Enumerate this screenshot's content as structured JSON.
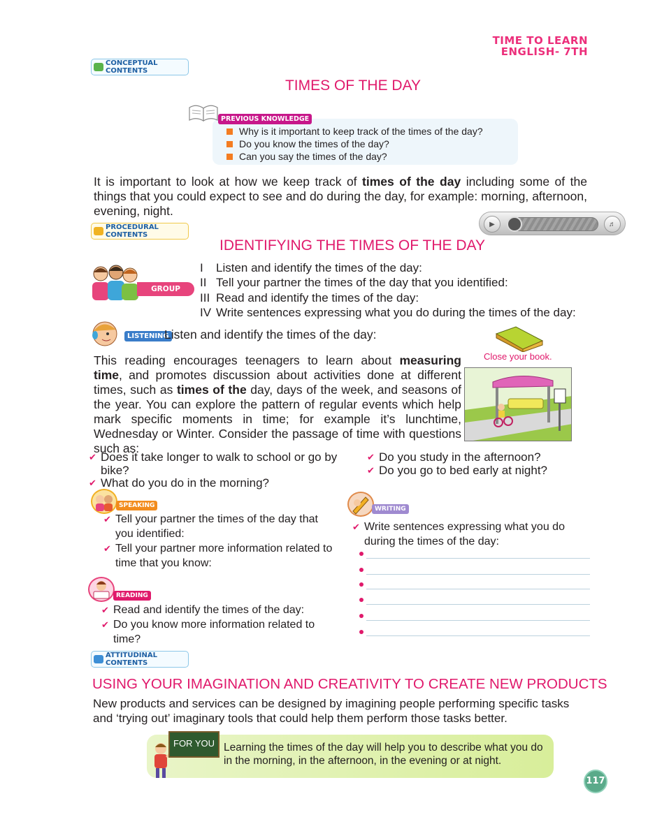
{
  "header": {
    "line1": "TIME TO LEARN",
    "line2": "ENGLISH- 7TH"
  },
  "tags": {
    "conceptual": "CONCEPTUAL CONTENTS",
    "procedural": "PROCEDURAL CONTENTS",
    "attitudinal": "ATTITUDINAL CONTENTS"
  },
  "title1": "TIMES OF THE DAY",
  "previous": {
    "label": "PREVIOUS KNOWLEDGE",
    "items": [
      "Why is it important to keep track of the times of the day?",
      "Do you know the times of the day?",
      "Can you say the times of the day?"
    ]
  },
  "intro": {
    "part1": "It is important to look at how we keep track of ",
    "bold": "times of the day",
    "part2": " including some of the things that you could expect to see and do during the day, for example: morning, afternoon, evening, night."
  },
  "audio": {
    "play": "play-icon",
    "volume": "volume-icon"
  },
  "title2": "IDENTIFYING THE TIMES OF THE DAY",
  "group_work": {
    "label": "GROUP WORK",
    "items": [
      {
        "num": "I",
        "text": "Listen and identify the times of the day:"
      },
      {
        "num": "II",
        "text": "Tell your partner the times of the day that you identified:"
      },
      {
        "num": "III",
        "text": "Read and identify the times of the day:"
      },
      {
        "num": "IV",
        "text": "Write sentences expressing what you do during the times of the day:"
      }
    ]
  },
  "listening": {
    "label": "LISTENING",
    "text": "Listen and identify the times of the day:"
  },
  "close_book": "Close your book.",
  "reading_passage": {
    "p1": "This reading  encourages teenagers to learn about ",
    "b1": "measuring time",
    "p2": ", and promotes discussion about activities done at different times, such as ",
    "b2": "times of the",
    "p3": " day, days of the week, and seasons of the year. You can explore  the  pattern  of regular events which help mark specific moments in time; for example it’s lunchtime, Wednesday or Winter. Consider the passage of time with questions such as:"
  },
  "questions_left": [
    "Does it take longer to walk to school or go by bike?",
    "What do you do in the morning?"
  ],
  "questions_right": [
    "Do you study in the afternoon?",
    "Do you go to bed early at night?"
  ],
  "speaking": {
    "label": "SPEAKING",
    "items": [
      "Tell your partner the times of the day that you identified:",
      "Tell your partner more information related to time that you know:"
    ]
  },
  "writing": {
    "label": "WRITING",
    "items": [
      "Write sentences expressing what you do during the times of the day:"
    ]
  },
  "reading": {
    "label": "READING",
    "items": [
      "Read and identify the times of the day:",
      "Do you know more information related to time?"
    ]
  },
  "title3": "USING YOUR IMAGINATION AND CREATIVITY TO CREATE NEW PRODUCTS",
  "creativity_text": "New products and services can be designed by imagining people performing specific tasks and ‘trying out’ imaginary tools that could help them perform those tasks better.",
  "for_you": {
    "label": "FOR YOU",
    "text": "Learning the times of the day will help you to describe what you do in the morning, in the afternoon, in the evening or at night."
  },
  "page_number": "117"
}
